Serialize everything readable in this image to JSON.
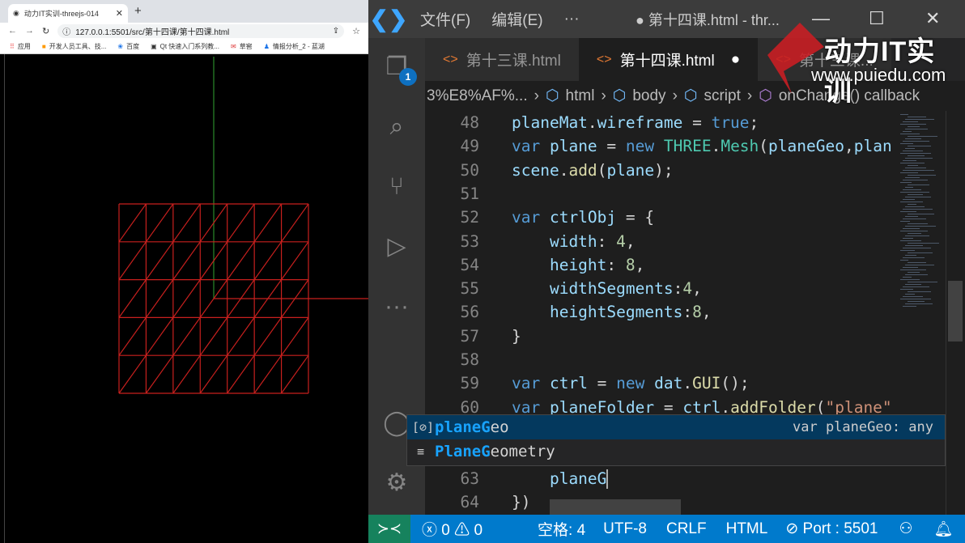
{
  "browser": {
    "tab_title": "动力IT实训-threejs-014",
    "url": "127.0.0.1:5501/src/第十四课/第十四课.html",
    "bookmarks": [
      "应用",
      "开发人员工具、技...",
      "百度",
      "Qt 快速入门系列教...",
      "草窖",
      "情报分析_2 - 蓝湖"
    ],
    "grid_cols": 7,
    "grid_rows": 5,
    "colors": {
      "mesh": "#c8201e",
      "axis_y": "#2a8a2a",
      "axis_x": "#c8201e"
    }
  },
  "vscode": {
    "menu": [
      "文件(F)",
      "编辑(E)",
      "···"
    ],
    "window_title": "● 第十四课.html - thr...",
    "explorer_badge": "1",
    "tabs": [
      {
        "label": "第十三课.html"
      },
      {
        "label": "第十四课.html",
        "dirty": "●"
      },
      {
        "label": "第十三课..."
      }
    ],
    "breadcrumb": [
      "3%E8%AF%...",
      "html",
      "body",
      "script",
      "onChange() callback"
    ],
    "lines": [
      {
        "n": "48",
        "t": [
          [
            "planeMat",
            "id"
          ],
          [
            ".",
            "pl"
          ],
          [
            "wireframe",
            "id"
          ],
          [
            " = ",
            "pl"
          ],
          [
            "true",
            "kw"
          ],
          [
            ";",
            "pl"
          ]
        ]
      },
      {
        "n": "49",
        "t": [
          [
            "var ",
            "kw"
          ],
          [
            "plane",
            "id"
          ],
          [
            " = ",
            "pl"
          ],
          [
            "new ",
            "kw"
          ],
          [
            "THREE",
            "cls"
          ],
          [
            ".",
            "pl"
          ],
          [
            "Mesh",
            "cls"
          ],
          [
            "(",
            "pl"
          ],
          [
            "planeGeo",
            "id"
          ],
          [
            ",",
            "pl"
          ],
          [
            "plan",
            "id"
          ]
        ]
      },
      {
        "n": "50",
        "t": [
          [
            "scene",
            "id"
          ],
          [
            ".",
            "pl"
          ],
          [
            "add",
            "fn"
          ],
          [
            "(",
            "pl"
          ],
          [
            "plane",
            "id"
          ],
          [
            ");",
            "pl"
          ]
        ]
      },
      {
        "n": "51",
        "t": []
      },
      {
        "n": "52",
        "t": [
          [
            "var ",
            "kw"
          ],
          [
            "ctrlObj",
            "id"
          ],
          [
            " = {",
            "pl"
          ]
        ]
      },
      {
        "n": "53",
        "t": [
          [
            "    width",
            "id"
          ],
          [
            ": ",
            "pl"
          ],
          [
            "4",
            "num"
          ],
          [
            ",",
            "pl"
          ]
        ]
      },
      {
        "n": "54",
        "t": [
          [
            "    height",
            "id"
          ],
          [
            ": ",
            "pl"
          ],
          [
            "8",
            "num"
          ],
          [
            ",",
            "pl"
          ]
        ]
      },
      {
        "n": "55",
        "t": [
          [
            "    widthSegments",
            "id"
          ],
          [
            ":",
            "pl"
          ],
          [
            "4",
            "num"
          ],
          [
            ",",
            "pl"
          ]
        ]
      },
      {
        "n": "56",
        "t": [
          [
            "    heightSegments",
            "id"
          ],
          [
            ":",
            "pl"
          ],
          [
            "8",
            "num"
          ],
          [
            ",",
            "pl"
          ]
        ]
      },
      {
        "n": "57",
        "t": [
          [
            "}",
            "pl"
          ]
        ]
      },
      {
        "n": "58",
        "t": []
      },
      {
        "n": "59",
        "t": [
          [
            "var ",
            "kw"
          ],
          [
            "ctrl",
            "id"
          ],
          [
            " = ",
            "pl"
          ],
          [
            "new ",
            "kw"
          ],
          [
            "dat",
            "id"
          ],
          [
            ".",
            "pl"
          ],
          [
            "GUI",
            "fn"
          ],
          [
            "();",
            "pl"
          ]
        ]
      },
      {
        "n": "60",
        "t": [
          [
            "var ",
            "kw"
          ],
          [
            "planeFolder",
            "id"
          ],
          [
            " = ",
            "pl"
          ],
          [
            "ctrl",
            "id"
          ],
          [
            ".",
            "pl"
          ],
          [
            "addFolder",
            "fn"
          ],
          [
            "(",
            "pl"
          ],
          [
            "\"plane\"",
            "str"
          ]
        ]
      },
      {
        "n": "63",
        "t": [
          [
            "    planeG",
            "id"
          ]
        ],
        "row": 15,
        "cursor": true
      },
      {
        "n": "64",
        "t": [
          [
            "})",
            "pl"
          ]
        ],
        "row": 16
      }
    ],
    "suggest": [
      {
        "match": "planeG",
        "rest": "eo",
        "detail": "var planeGeo: any",
        "icon": "variable-icon"
      },
      {
        "match": "PlaneG",
        "rest": "eometry",
        "icon": "text-icon"
      }
    ],
    "status": {
      "errors": "0",
      "warnings": "0",
      "spaces": "空格: 4",
      "encoding": "UTF-8",
      "eol": "CRLF",
      "language": "HTML",
      "port": "Port : 5501"
    },
    "colors": {
      "accent": "#007acc",
      "remote": "#16825d"
    }
  },
  "watermark": {
    "brand": "动力IT实训",
    "site": "www.puiedu.com"
  }
}
